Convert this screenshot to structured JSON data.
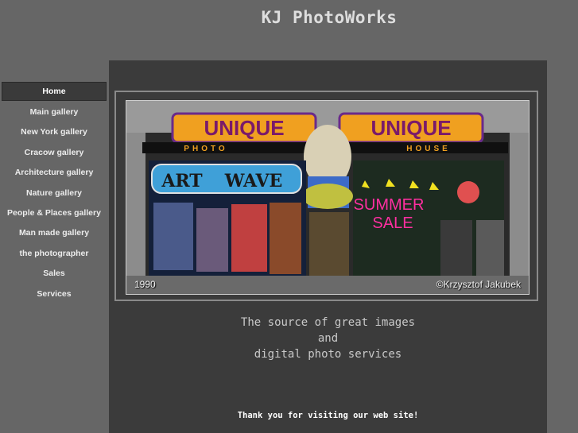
{
  "site": {
    "title": "KJ PhotoWorks"
  },
  "nav": {
    "items": [
      {
        "label": "Home"
      },
      {
        "label": "Main gallery"
      },
      {
        "label": "New York gallery"
      },
      {
        "label": "Cracow gallery"
      },
      {
        "label": "Architecture gallery"
      },
      {
        "label": "Nature gallery"
      },
      {
        "label": "People & Places gallery"
      },
      {
        "label": "Man made gallery"
      },
      {
        "label": "the photographer"
      },
      {
        "label": "Sales"
      },
      {
        "label": "Services"
      }
    ]
  },
  "photo": {
    "year": "1990",
    "copyright": "©Krzysztof Jakubek",
    "signs": {
      "unique": "UNIQUE",
      "photo": "PHOTO",
      "house": "HOUSE",
      "artwave_1": "ART",
      "artwave_2": "WAVE",
      "summer": "SUMMER",
      "sale": "SALE"
    }
  },
  "tagline": {
    "line1": "The source of great images",
    "line2": "and",
    "line3": "digital photo services"
  },
  "footer": {
    "thanks": "Thank you for visiting our web site!"
  },
  "colors": {
    "background": "#666666",
    "panel": "#3b3b3b",
    "accent_sign": "#f0a020"
  }
}
